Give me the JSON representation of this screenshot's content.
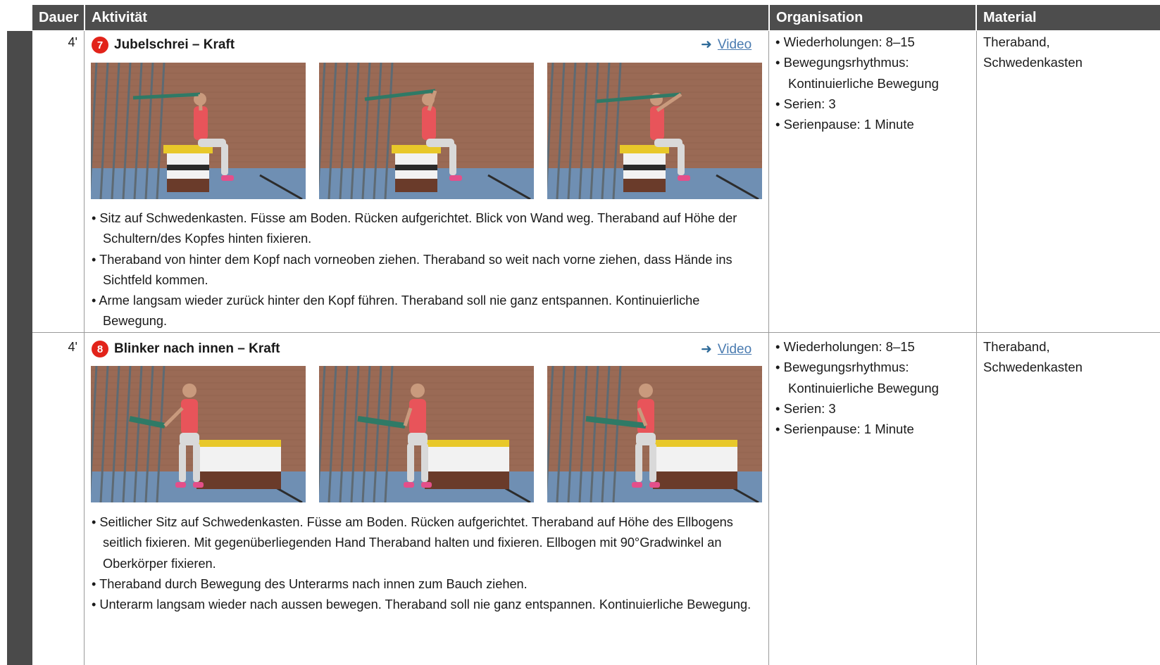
{
  "header": {
    "dauer": "Dauer",
    "aktivitaet": "Aktivität",
    "organisation": "Organisation",
    "material": "Material"
  },
  "exercises": [
    {
      "duration": "4'",
      "number": "7",
      "title": "Jubelschrei – Kraft",
      "video_link": "Video",
      "photos": [
        {
          "pose": "seated-arms-behind-head"
        },
        {
          "pose": "seated-pulling-forward"
        },
        {
          "pose": "seated-arms-forward-up"
        }
      ],
      "description": [
        "Sitz auf Schwedenkasten. Füsse am Boden. Rücken aufgerichtet. Blick von Wand weg. Theraband auf Höhe der Schultern/des Kopfes hinten fixieren.",
        "Theraband von hinter dem Kopf nach vorneoben ziehen. Theraband so weit nach vorne ziehen, dass Hände ins Sichtfeld kommen.",
        "Arme langsam wieder zurück hinter den Kopf führen. Theraband soll nie ganz entspannen. Kontinuierliche Bewegung."
      ],
      "organisation": [
        "Wiederholungen: 8–15",
        "Bewegungsrhythmus: Kontinuierliche Bewegung",
        "Serien: 3",
        "Serienpause: 1 Minute"
      ],
      "material": [
        "Theraband,",
        "Schwedenkasten"
      ]
    },
    {
      "duration": "4'",
      "number": "8",
      "title": "Blinker nach innen – Kraft",
      "video_link": "Video",
      "photos": [
        {
          "pose": "side-seated-band-out"
        },
        {
          "pose": "side-seated-band-mid"
        },
        {
          "pose": "side-seated-band-in"
        }
      ],
      "description": [
        "Seitlicher Sitz auf Schwedenkasten. Füsse am Boden. Rücken aufgerichtet. Theraband auf Höhe des Ellbogens seitlich fixieren. Mit gegenüberliegenden Hand Theraband halten und fixieren. Ellbogen mit 90°Gradwinkel an Oberkörper fixieren.",
        "Theraband durch Bewegung des Unterarms nach innen zum Bauch ziehen.",
        "Unterarm langsam wieder nach aussen bewegen. Theraband soll nie ganz entspannen. Kontinuierliche Bewegung."
      ],
      "organisation": [
        "Wiederholungen: 8–15",
        "Bewegungsrhythmus: Kontinuierliche Bewegung",
        "Serien: 3",
        "Serienpause: 1 Minute"
      ],
      "material": [
        "Theraband,",
        "Schwedenkasten"
      ]
    }
  ],
  "colors": {
    "header_bg": "#4d4d4d",
    "sidebar": "#4a4a4a",
    "badge": "#e2231a",
    "link": "#4a7bb0",
    "wall": "#9a6a55",
    "floor": "#6f8fb3",
    "shirt": "#e8545a",
    "band": "#2f7a66"
  }
}
